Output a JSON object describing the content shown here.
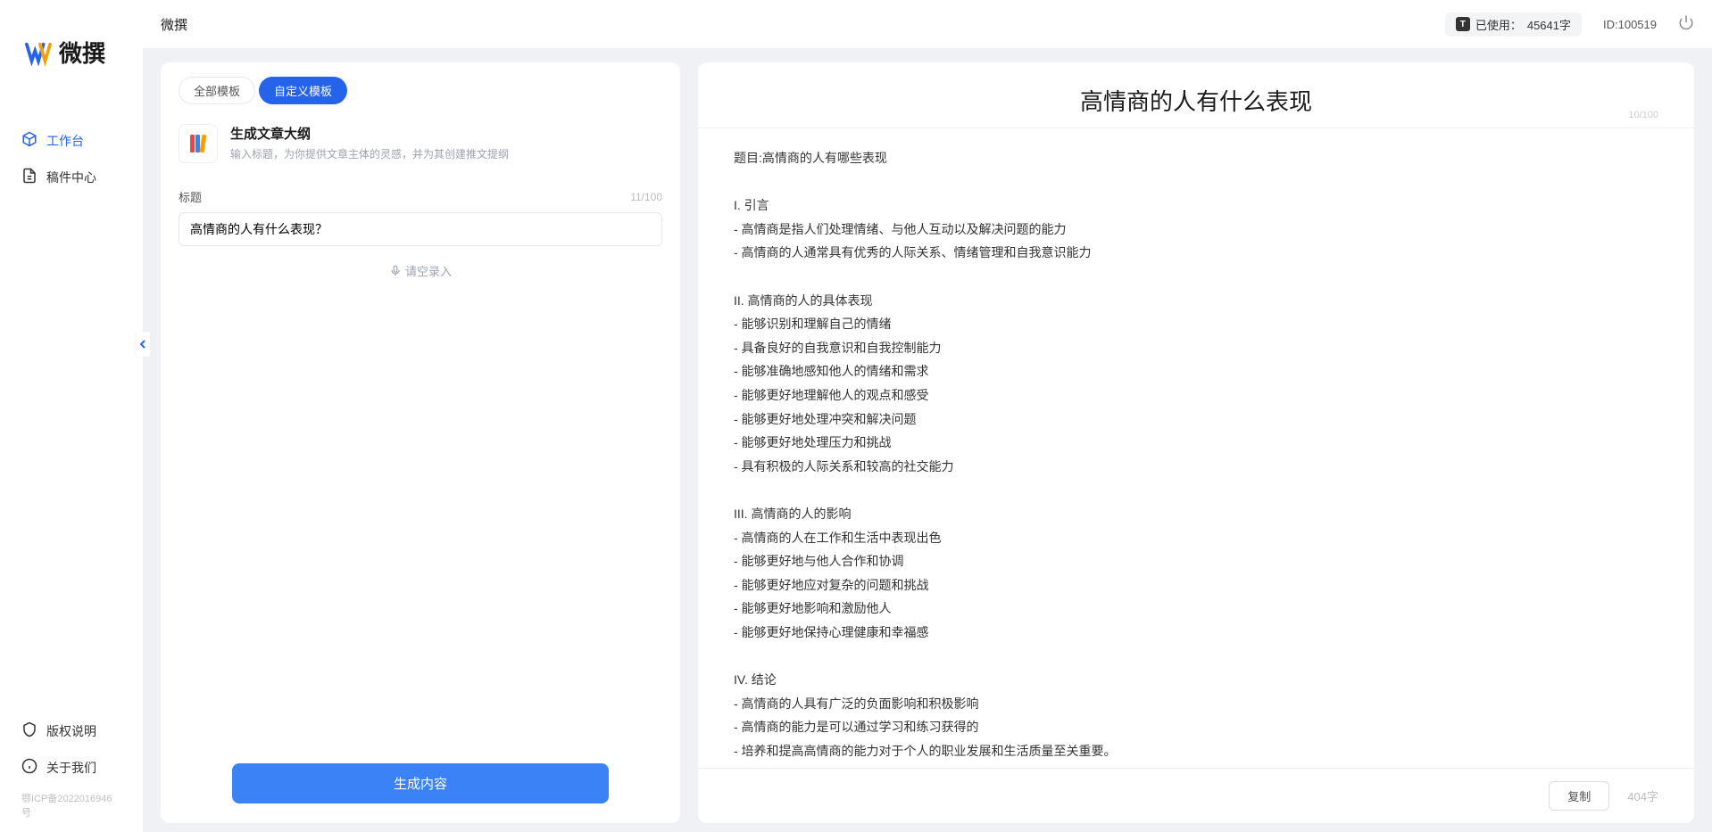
{
  "app": {
    "name": "微撰",
    "logo_text": "微撰"
  },
  "header": {
    "usage_prefix": "已使用：",
    "usage_value": "45641字",
    "id_label": "ID:100519"
  },
  "sidebar": {
    "items": [
      {
        "label": "工作台",
        "active": true
      },
      {
        "label": "稿件中心",
        "active": false
      }
    ],
    "bottom_items": [
      {
        "label": "版权说明"
      },
      {
        "label": "关于我们"
      }
    ],
    "icp": "鄂ICP备2022016946号"
  },
  "left_panel": {
    "tabs": [
      {
        "label": "全部模板",
        "active": false
      },
      {
        "label": "自定义模板",
        "active": true
      }
    ],
    "template": {
      "title": "生成文章大纲",
      "desc": "输入标题，为你提供文章主体的灵感，并为其创建推文提纲"
    },
    "form": {
      "title_label": "标题",
      "char_count": "11/100",
      "input_value": "高情商的人有什么表现？",
      "voice_label": "请空录入"
    },
    "generate_button": "生成内容"
  },
  "right_panel": {
    "title": "高情商的人有什么表现",
    "counter": "10/100",
    "content": "题目:高情商的人有哪些表现\n\nI. 引言\n- 高情商是指人们处理情绪、与他人互动以及解决问题的能力\n- 高情商的人通常具有优秀的人际关系、情绪管理和自我意识能力\n\nII. 高情商的人的具体表现\n- 能够识别和理解自己的情绪\n- 具备良好的自我意识和自我控制能力\n- 能够准确地感知他人的情绪和需求\n- 能够更好地理解他人的观点和感受\n- 能够更好地处理冲突和解决问题\n- 能够更好地处理压力和挑战\n- 具有积极的人际关系和较高的社交能力\n\nIII. 高情商的人的影响\n- 高情商的人在工作和生活中表现出色\n- 能够更好地与他人合作和协调\n- 能够更好地应对复杂的问题和挑战\n- 能够更好地影响和激励他人\n- 能够更好地保持心理健康和幸福感\n\nIV. 结论\n- 高情商的人具有广泛的负面影响和积极影响\n- 高情商的能力是可以通过学习和练习获得的\n- 培养和提高高情商的能力对于个人的职业发展和生活质量至关重要。",
    "copy_button": "复制",
    "word_count": "404字"
  }
}
